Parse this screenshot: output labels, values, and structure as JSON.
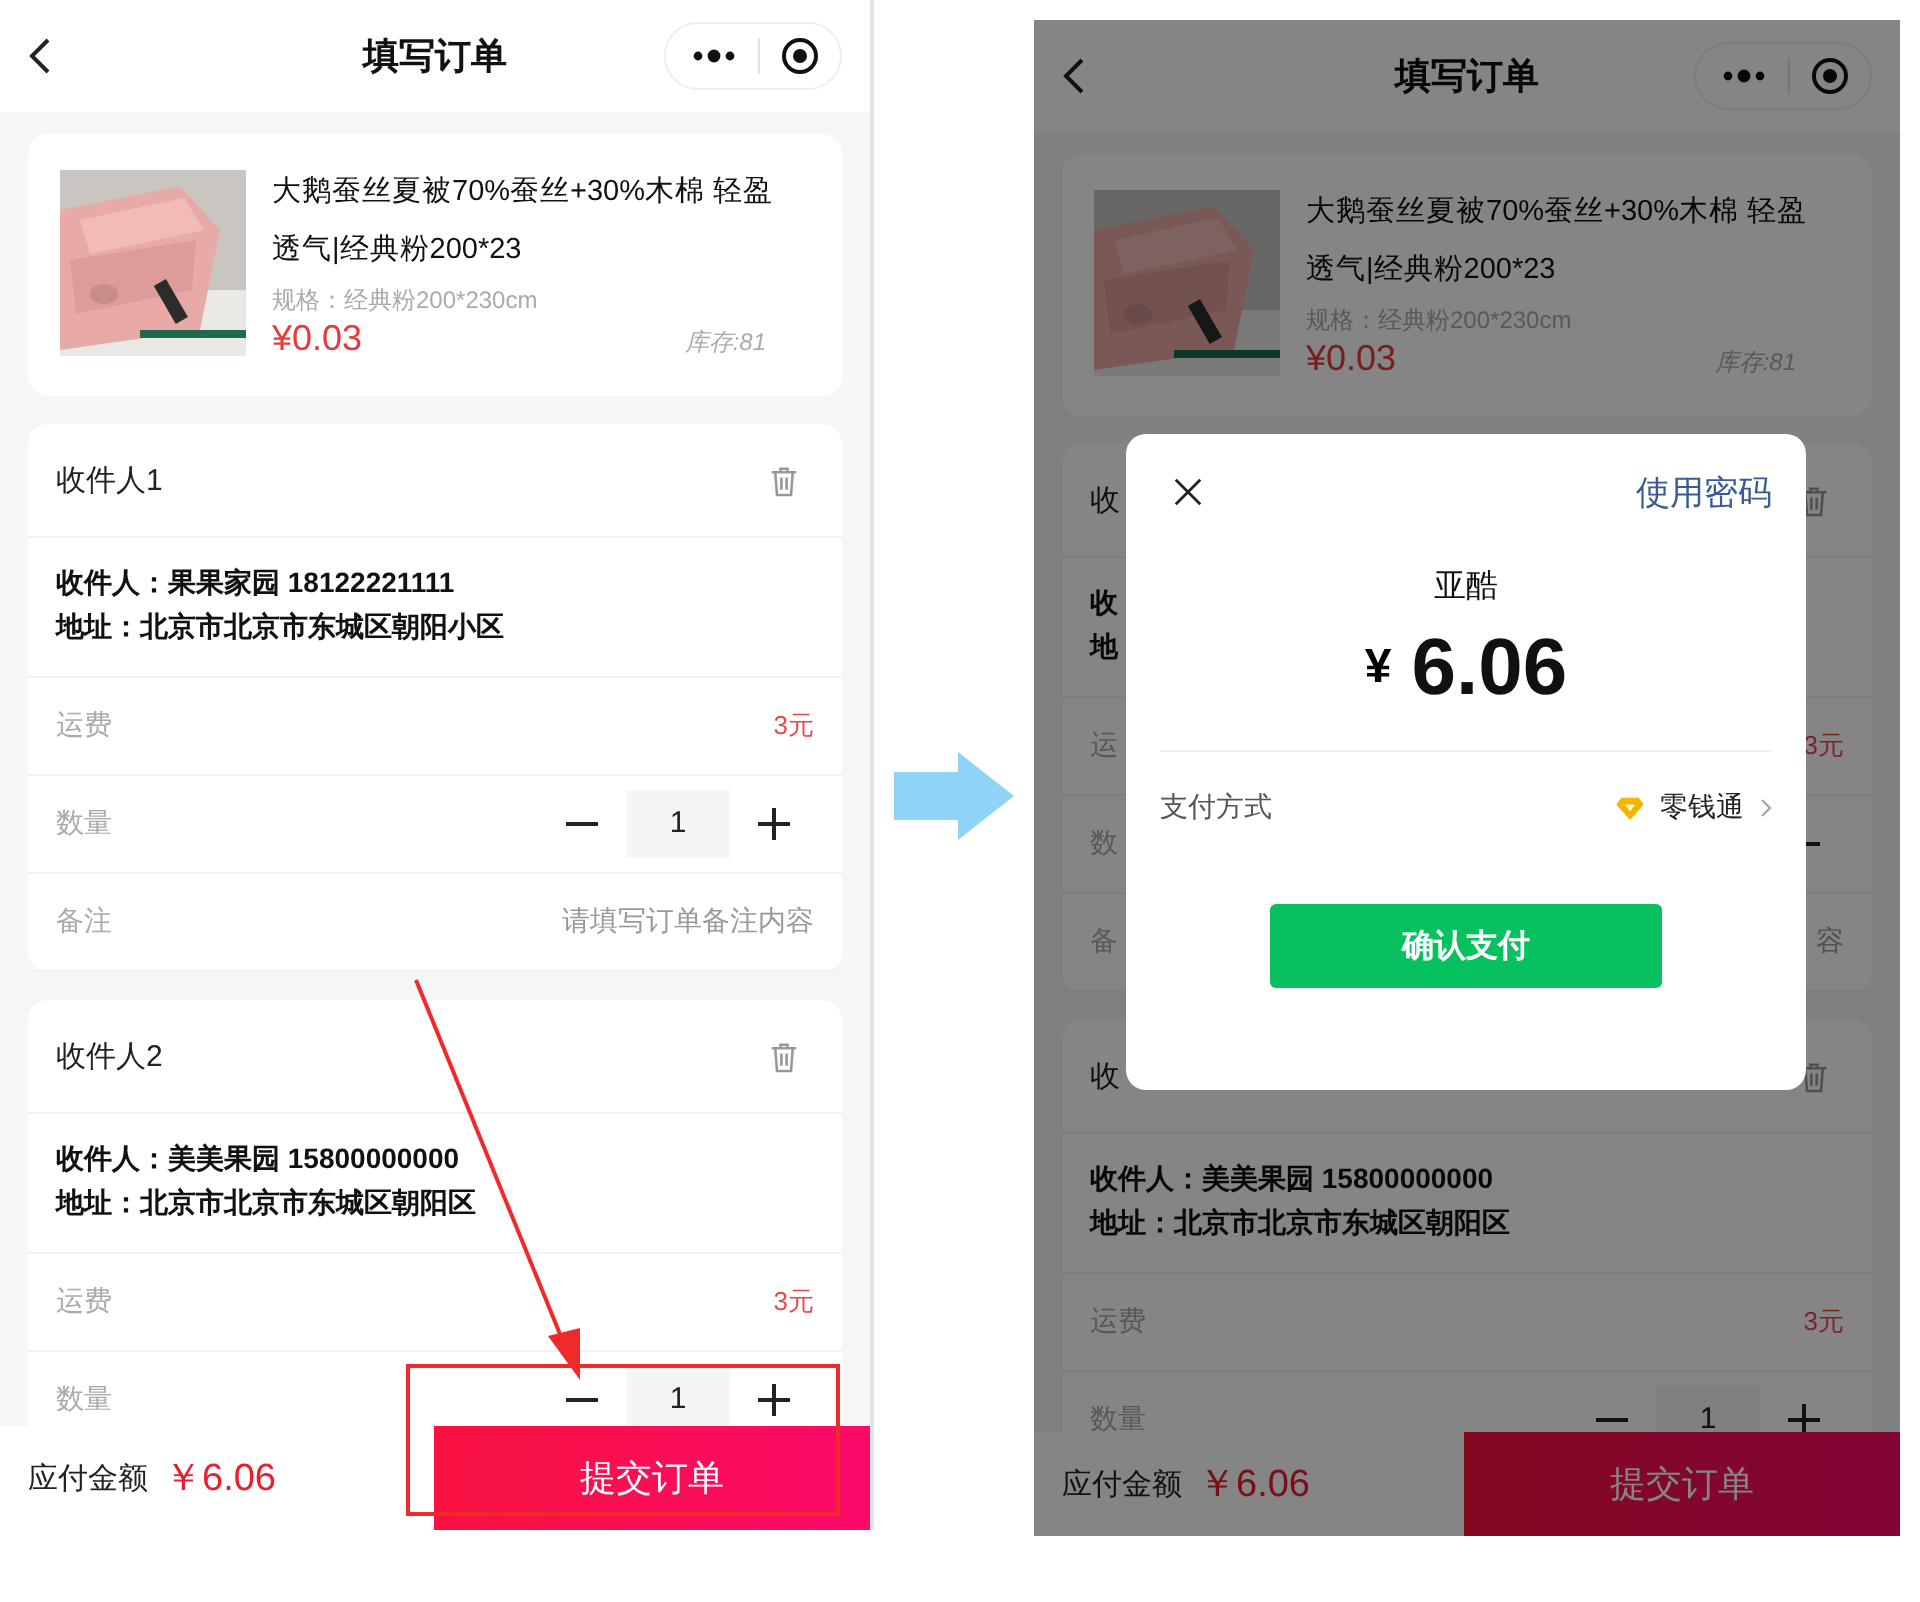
{
  "left_screen": {
    "nav_title": "填写订单",
    "product": {
      "title": "大鹅蚕丝夏被70%蚕丝+30%木棉 轻盈透气|经典粉200*23",
      "spec": "规格：经典粉200*230cm",
      "price": "¥0.03",
      "stock": "库存:81"
    },
    "recipients": [
      {
        "title": "收件人1",
        "name_line": "收件人：果果家园 18122221111",
        "address_line": "地址：北京市北京市东城区朝阳小区",
        "rows": [
          {
            "kind": "fee",
            "label": "运费",
            "value": "3元"
          },
          {
            "kind": "quantity",
            "label": "数量",
            "value": "1"
          },
          {
            "kind": "note",
            "label": "备注",
            "placeholder": "请填写订单备注内容"
          }
        ]
      },
      {
        "title": "收件人2",
        "name_line": "收件人：美美果园 15800000000",
        "address_line": "地址：北京市北京市东城区朝阳区",
        "rows": [
          {
            "kind": "fee",
            "label": "运费",
            "value": "3元"
          },
          {
            "kind": "quantity",
            "label": "数量",
            "value": "1"
          }
        ]
      }
    ],
    "footer": {
      "label": "应付金额",
      "amount": "￥6.06",
      "submit": "提交订单"
    }
  },
  "right_screen": {
    "nav_title": "填写订单",
    "product": {
      "title": "大鹅蚕丝夏被70%蚕丝+30%木棉 轻盈透气|经典粉200*23",
      "spec": "规格：经典粉200*230cm",
      "price": "¥0.03",
      "stock": "库存:81"
    },
    "recipients": [
      {
        "title": "收",
        "name_line": "收",
        "address_line": "地",
        "rows": [
          {
            "kind": "fee",
            "label": "运",
            "value": "3元"
          },
          {
            "kind": "quantity",
            "label": "数"
          },
          {
            "kind": "note",
            "label": "备",
            "placeholder": "容"
          }
        ]
      },
      {
        "title": "收",
        "name_line": "收件人：美美果园 15800000000",
        "address_line": "地址：北京市北京市东城区朝阳区",
        "rows": [
          {
            "kind": "fee",
            "label": "运费",
            "value": "3元"
          },
          {
            "kind": "quantity",
            "label": "数量",
            "value": "1"
          }
        ]
      }
    ],
    "footer": {
      "label": "应付金额",
      "amount": "￥6.06",
      "submit": "提交订单"
    },
    "payment_dialog": {
      "password_link": "使用密码",
      "payee": "亚酷",
      "amount_symbol": "¥",
      "amount": "6.06",
      "method_label": "支付方式",
      "method_value": "零钱通",
      "confirm": "确认支付"
    }
  }
}
